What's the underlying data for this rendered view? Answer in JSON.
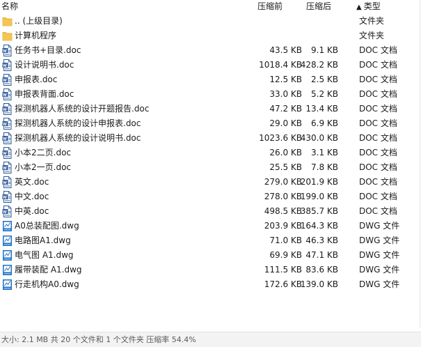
{
  "header": {
    "name": "名称",
    "original": "压缩前",
    "compressed": "压缩后",
    "type": "类型",
    "sort_arrow": "▲"
  },
  "files": [
    {
      "name": ".. (上级目录)",
      "original": "",
      "compressed": "",
      "type": "文件夹",
      "icon": "folder-icon"
    },
    {
      "name": "计算机程序",
      "original": "",
      "compressed": "",
      "type": "文件夹",
      "icon": "folder-icon"
    },
    {
      "name": "任务书+目录.doc",
      "original": "43.5 KB",
      "compressed": "9.1 KB",
      "type": "DOC 文档",
      "icon": "word-doc-icon"
    },
    {
      "name": "设计说明书.doc",
      "original": "1018.4 KB",
      "compressed": "428.2 KB",
      "type": "DOC 文档",
      "icon": "word-doc-icon"
    },
    {
      "name": "申报表.doc",
      "original": "12.5 KB",
      "compressed": "2.5 KB",
      "type": "DOC 文档",
      "icon": "word-doc-icon"
    },
    {
      "name": "申报表背面.doc",
      "original": "33.0 KB",
      "compressed": "5.2 KB",
      "type": "DOC 文档",
      "icon": "word-doc-icon"
    },
    {
      "name": "探测机器人系统的设计开题报告.doc",
      "original": "47.2 KB",
      "compressed": "13.4 KB",
      "type": "DOC 文档",
      "icon": "word-doc-icon"
    },
    {
      "name": "探测机器人系统的设计申报表.doc",
      "original": "29.0 KB",
      "compressed": "6.9 KB",
      "type": "DOC 文档",
      "icon": "word-doc-icon"
    },
    {
      "name": "探测机器人系统的设计说明书.doc",
      "original": "1023.6 KB",
      "compressed": "430.0 KB",
      "type": "DOC 文档",
      "icon": "word-doc-icon"
    },
    {
      "name": "小本2二页.doc",
      "original": "26.0 KB",
      "compressed": "3.1 KB",
      "type": "DOC 文档",
      "icon": "word-doc-icon"
    },
    {
      "name": "小本2一页.doc",
      "original": "25.5 KB",
      "compressed": "7.8 KB",
      "type": "DOC 文档",
      "icon": "word-doc-icon"
    },
    {
      "name": "英文.doc",
      "original": "279.0 KB",
      "compressed": "201.9 KB",
      "type": "DOC 文档",
      "icon": "word-doc-icon"
    },
    {
      "name": "中文.doc",
      "original": "278.0 KB",
      "compressed": "199.0 KB",
      "type": "DOC 文档",
      "icon": "word-doc-icon"
    },
    {
      "name": "中英.doc",
      "original": "498.5 KB",
      "compressed": "385.7 KB",
      "type": "DOC 文档",
      "icon": "word-doc-icon"
    },
    {
      "name": "A0总装配图.dwg",
      "original": "203.9 KB",
      "compressed": "164.3 KB",
      "type": "DWG 文件",
      "icon": "dwg-file-icon"
    },
    {
      "name": "电路图A1.dwg",
      "original": "71.0 KB",
      "compressed": "46.3 KB",
      "type": "DWG 文件",
      "icon": "dwg-file-icon"
    },
    {
      "name": "电气图 A1.dwg",
      "original": "69.9 KB",
      "compressed": "47.1 KB",
      "type": "DWG 文件",
      "icon": "dwg-file-icon"
    },
    {
      "name": "履带装配 A1.dwg",
      "original": "111.5 KB",
      "compressed": "83.6 KB",
      "type": "DWG 文件",
      "icon": "dwg-file-icon"
    },
    {
      "name": "行走机构A0.dwg",
      "original": "172.6 KB",
      "compressed": "139.0 KB",
      "type": "DWG 文件",
      "icon": "dwg-file-icon"
    }
  ],
  "status": {
    "text": "大小: 2.1 MB 共 20 个文件和 1 个文件夹 压缩率 54.4%"
  },
  "colors": {
    "folder": "#f5c451",
    "word_doc": "#2b5797",
    "dwg": "#1e6fc4"
  }
}
